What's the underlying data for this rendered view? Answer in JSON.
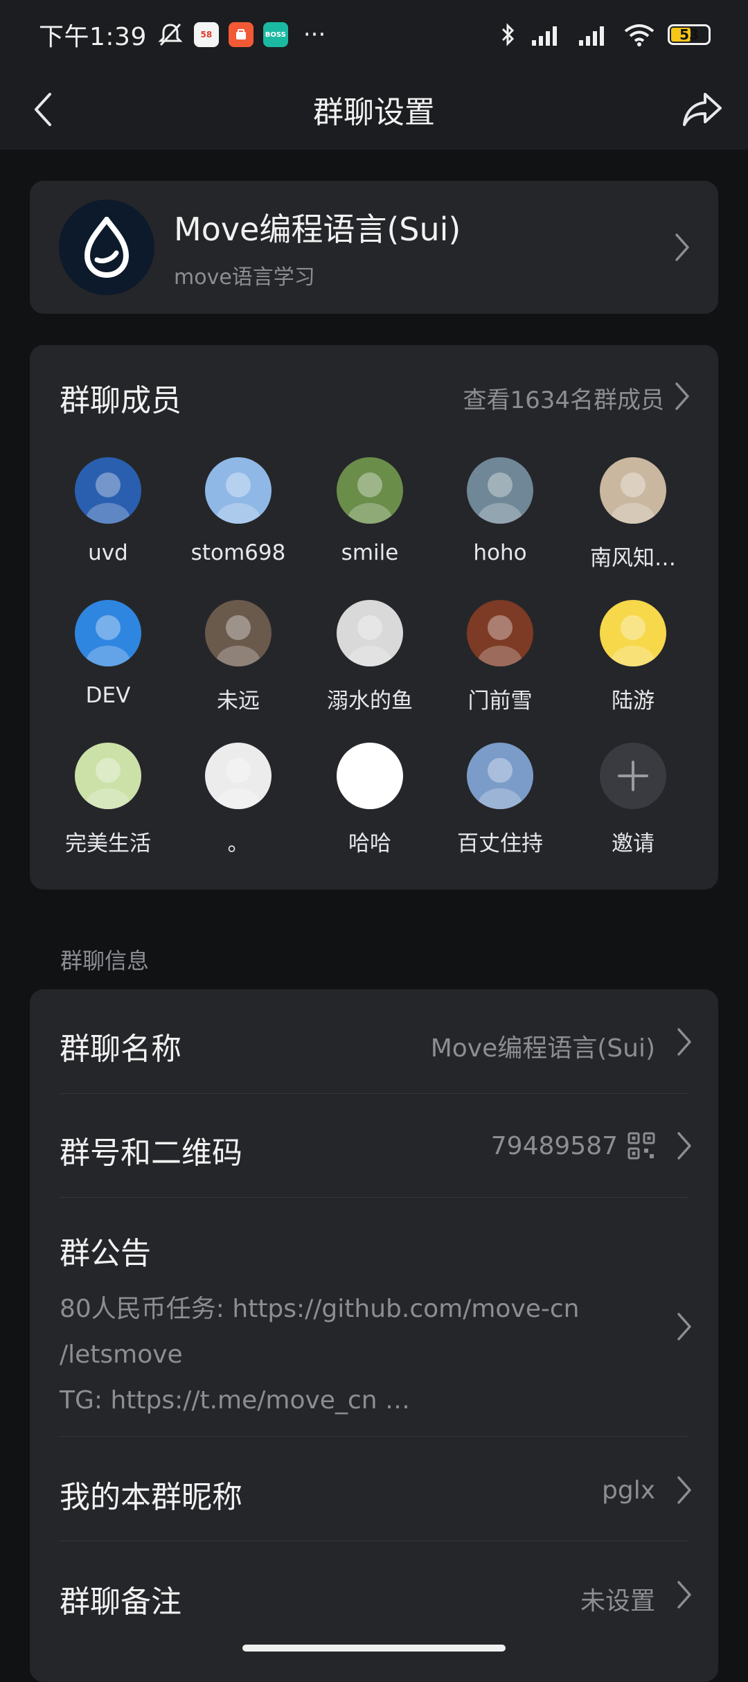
{
  "status_bar": {
    "time": "下午1:39",
    "dots": "···",
    "battery": "53",
    "badges": [
      "58",
      "BOSS"
    ]
  },
  "nav": {
    "title": "群聊设置"
  },
  "group": {
    "name": "Move编程语言(Sui)",
    "subtitle": "move语言学习"
  },
  "members": {
    "title": "群聊成员",
    "link": "查看1634名群成员",
    "items": [
      {
        "name": "uvd",
        "color": "#2a5fb0"
      },
      {
        "name": "stom698",
        "color": "#8fb8e6"
      },
      {
        "name": "smile",
        "color": "#6a8d4a"
      },
      {
        "name": "hoho",
        "color": "#6f8796"
      },
      {
        "name": "南风知…",
        "color": "#c9b79f"
      },
      {
        "name": "DEV",
        "color": "#2f86e0"
      },
      {
        "name": "未远",
        "color": "#6a5a4c"
      },
      {
        "name": "溺水的鱼",
        "color": "#d9d9d9"
      },
      {
        "name": "门前雪",
        "color": "#7d3a24"
      },
      {
        "name": "陆游",
        "color": "#f6d84a"
      },
      {
        "name": "完美生活",
        "color": "#cbe1a8"
      },
      {
        "name": "。",
        "color": "#ececec"
      },
      {
        "name": "哈哈",
        "color": "#ffffff"
      },
      {
        "name": "百丈住持",
        "color": "#7b9cc9"
      },
      {
        "name": "邀请",
        "color": "#3a3b40"
      }
    ]
  },
  "info": {
    "section_label": "群聊信息",
    "group_name_label": "群聊名称",
    "group_name_value": "Move编程语言(Sui)",
    "group_id_label": "群号和二维码",
    "group_id_value": "79489587",
    "notice_label": "群公告",
    "notice_line1": "80人民币任务: https://github.com/move-cn",
    "notice_line2": "/letsmove",
    "notice_line3": "TG: https://t.me/move_cn …",
    "nickname_label": "我的本群昵称",
    "nickname_value": "pglx",
    "remark_label": "群聊备注",
    "remark_value": "未设置"
  }
}
